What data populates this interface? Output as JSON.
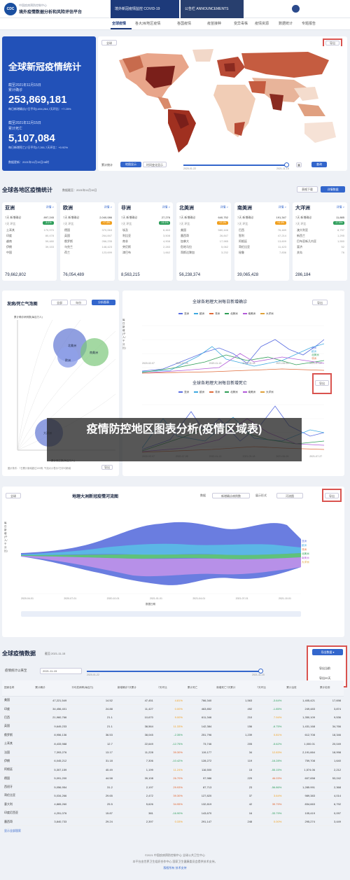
{
  "header": {
    "org": "中国疾病预防控制中心",
    "platform": "境外疫情数据分析和风险评估平台",
    "logo": "CDC",
    "top_tabs": [
      "境外新冠疫情监控 COVID-19",
      "公告栏 ANNOUNCEMENTS"
    ]
  },
  "nav": [
    "全球疫情",
    "各大洲/地区疫情",
    "各国疫情",
    "疫苗接种",
    "变异毒株",
    "疫情资源",
    "数据统计",
    "专题报告"
  ],
  "world": {
    "panel_title": "全球新冠疫情统计",
    "cum_date": "截至2021年11月15日",
    "cum_label": "累计确诊",
    "cum_value": "253,869,181",
    "cum_note": "每日新增确诊(7日平均):494,264,7天环比：+7.25%",
    "death_date": "截至2021年11月15日",
    "death_label": "累计死亡",
    "death_value": "5,107,084",
    "death_note": "每日新增死亡(7日平均):7,261,7天环比：+0.92%",
    "update": "数据更新：2021年11月15日08时",
    "map_select": "全球",
    "map_btn": "导出",
    "stat_label": "累计统计",
    "toggle_a": "地图显示",
    "toggle_b": "时间变化显示",
    "date_start": "2020-01-22",
    "date_end": "2021-11-15",
    "query_btn": "查询"
  },
  "regions": {
    "title": "全球各地区疫情统计",
    "date": "数据截至：2021年11月15日",
    "btn_export": "表格下载",
    "btn_detail": "详情数据",
    "items": [
      {
        "name": "亚洲",
        "link": "详情 >",
        "lbl": "7天 新增确诊",
        "val": "897,245",
        "badge": "-8.1%",
        "badge_color": "#2e9e5b",
        "trend": "7天 环比",
        "rows": [
          [
            "土耳其",
            "170,970"
          ],
          [
            "印度",
            "80,478"
          ],
          [
            "越南",
            "59,480"
          ],
          [
            "伊朗",
            "39,153"
          ],
          [
            "中国",
            ""
          ]
        ],
        "total": "79,662,802"
      },
      {
        "name": "欧洲",
        "link": "详情 >",
        "lbl": "7天 新增确诊",
        "val": "2,040,086",
        "badge": "+7.4%",
        "badge_color": "#f0a020",
        "trend": "7天 环比",
        "rows": [
          [
            "德国",
            "370,063"
          ],
          [
            "英国",
            "264,847"
          ],
          [
            "俄罗斯",
            "266,235"
          ],
          [
            "乌克兰",
            "148,423"
          ],
          [
            "荷兰",
            "123,699"
          ]
        ],
        "total": "76,054,489"
      },
      {
        "name": "非洲",
        "link": "详情 >",
        "lbl": "7天 新增确诊",
        "val": "27,276",
        "badge": "-16.1%",
        "badge_color": "#2e9e5b",
        "trend": "7天 环比",
        "rows": [
          [
            "埃及",
            "6,463"
          ],
          [
            "利比亚",
            "3,508"
          ],
          [
            "南非",
            "4,908"
          ],
          [
            "突尼斯",
            "2,283"
          ],
          [
            "津巴布",
            "1,662"
          ]
        ],
        "total": "8,563,215"
      },
      {
        "name": "北美洲",
        "link": "详情 >",
        "lbl": "7天 新增确诊",
        "val": "640,752",
        "badge": "+2.1%",
        "badge_color": "#f0a020",
        "trend": "7天 环比",
        "rows": [
          [
            "美国",
            "580,446"
          ],
          [
            "墨西哥",
            "26,847"
          ],
          [
            "加拿大",
            "17,985"
          ],
          [
            "危地马拉",
            "5,062"
          ],
          [
            "哥斯达黎加",
            "3,232"
          ]
        ],
        "total": "56,238,374"
      },
      {
        "name": "南美洲",
        "link": "详情 >",
        "lbl": "7天 新增确诊",
        "val": "191,347",
        "badge": "+4.4%",
        "badge_color": "#f0a020",
        "trend": "7天 环比",
        "rows": [
          [
            "巴西",
            "76,489"
          ],
          [
            "智利",
            "47,214"
          ],
          [
            "阿根廷",
            "13,609"
          ],
          [
            "哥伦比亚",
            "11,423"
          ],
          [
            "秘鲁",
            "7,836"
          ]
        ],
        "total": "39,065,428"
      },
      {
        "name": "大洋洲",
        "link": "详情 >",
        "lbl": "7天 新增确诊",
        "val": "11,885",
        "badge": "-17.8%",
        "badge_color": "#2e9e5b",
        "trend": "7天 环比",
        "rows": [
          [
            "澳大利亚",
            "8,797"
          ],
          [
            "新西兰",
            "1,295"
          ],
          [
            "巴布亚新几内亚",
            "1,550"
          ],
          [
            "斐济",
            "52"
          ],
          [
            "关岛",
            "76"
          ]
        ],
        "total": "286,184"
      }
    ]
  },
  "bubble": {
    "title": "发病/死亡气泡图",
    "select": "全部",
    "select2": "年份",
    "btn": "分析图表",
    "yaxis": "累计确诊病例数(每百万人)",
    "xaxis": "累计死亡数(每百万人)",
    "note": "图示条件：7日累计新增超过100例, 气泡大小表示7日平均新增",
    "export": "导出",
    "bubbles": [
      {
        "label": "北美洲",
        "color": "#6b7fd6"
      },
      {
        "label": "南美洲",
        "color": "#7cc77a"
      },
      {
        "label": "欧洲",
        "color": "#6b7fd6"
      },
      {
        "label": "大洋洲",
        "color": "#6b7fd6"
      }
    ]
  },
  "lines": {
    "export": "导出",
    "chart1_title": "全球各地理大洲每日新增确诊",
    "chart2_title": "全球各地理大洲每日新增死亡",
    "legend": [
      "亚洲",
      "欧洲",
      "非洲",
      "北美洲",
      "南美洲",
      "大洋洲"
    ],
    "legend_colors": [
      "#5b6ee1",
      "#3fa9e0",
      "#e06b3a",
      "#2f9e57",
      "#b35bd9",
      "#e0a23a"
    ],
    "ylabel1": "每日新增(千人/千分比)",
    "x_ticks": [
      "2020-02-07",
      "2020-07-05",
      "2020-11-13",
      "2021-03-18",
      "2021-06-05",
      "2021-07-27"
    ]
  },
  "stream": {
    "region_select": "全球",
    "title": "地理大洲新冠疫情河流图",
    "label_data": "数据",
    "data_select": "新增确诊病例数",
    "label_display": "展示形式",
    "display_select": "河流图",
    "btn": "导出",
    "ylabel": "每日新增(千人/千分比)",
    "xlabel": "数据日期",
    "x_ticks": [
      "2020-04-01",
      "2020-07-01",
      "2020-10-01",
      "2021-01-01",
      "2021-04-01",
      "2021-07-01",
      "2021-10-01"
    ],
    "legend": [
      "亚洲",
      "欧洲",
      "非洲",
      "北美洲",
      "南美洲",
      "大洋洲"
    ]
  },
  "table": {
    "title": "全球疫情数据",
    "date": "截至:2021-11-15",
    "filter_label": "疫情统计以来至",
    "filter_value": "2021-11-15",
    "slider_start": "2020-01-22",
    "slider_end": "2021-11-15",
    "export_btn": "导出数据",
    "menu": [
      "导出当前",
      "导出20天"
    ],
    "columns": [
      "国家名称",
      "累计确诊",
      "平均发病率(每百万)",
      "新增确诊7天累计",
      "7天环比",
      "累计死亡",
      "新增死亡7天累计",
      "7天环比",
      "累计治愈",
      "累计检测"
    ],
    "rows": [
      [
        "美国",
        "47,221,549",
        "14.52",
        "47,451",
        "4.81%",
        "766,340",
        "1,563",
        "-3.64%",
        "1,405,421",
        "17,698"
      ],
      [
        "印度",
        "34,456,401",
        "24.88",
        "11,427",
        "0.00%",
        "463,852",
        "492",
        "-1.85%",
        "249,483",
        "3,874"
      ],
      [
        "巴西",
        "21,960,766",
        "21.1",
        "10,670",
        "9.00%",
        "611,346",
        "210",
        "7.94%",
        "1,350,109",
        "9,536"
      ],
      [
        "英国",
        "9,649,233",
        "21.1",
        "38,564",
        "11.33%",
        "142,384",
        "156",
        "-6.75%",
        "1,431,168",
        "34,766"
      ],
      [
        "俄罗斯",
        "8,956,136",
        "36.53",
        "38,045",
        "-2.35%",
        "251,796",
        "1,239",
        "0.81%",
        "612,708",
        "18,346"
      ],
      [
        "土耳其",
        "8,433,988",
        "12.7",
        "22,649",
        "-12.75%",
        "73,746",
        "205",
        "-5.62%",
        "1,000.01",
        "20,049"
      ],
      [
        "法国",
        "7,393,276",
        "13.17",
        "11,228",
        "39.30%",
        "119,177",
        "34",
        "12.83%",
        "2,191,664",
        "18,998"
      ],
      [
        "伊朗",
        "6,045,212",
        "31.18",
        "7,306",
        "-10.42%",
        "128,272",
        "119",
        "-16.28%",
        "759,708",
        "1,640"
      ],
      [
        "阿根廷",
        "5,307,159",
        "40.49",
        "1,199",
        "11.24%",
        "116,500",
        "15",
        "-55.15%",
        "1,574.06",
        "2,212"
      ],
      [
        "德国",
        "5,091,200",
        "44.58",
        "39,108",
        "26.70%",
        "97,986",
        "229",
        "46.03%",
        "607,658",
        "53,242"
      ],
      [
        "西班牙",
        "5,056,954",
        "31.2",
        "2,197",
        "29.93%",
        "87,713",
        "23",
        "-56.86%",
        "1,285.991",
        "2,368"
      ],
      [
        "哥伦比亚",
        "5,034,266",
        "29.65",
        "2,472",
        "39.30%",
        "127,820",
        "37",
        "3.64%",
        "989,383",
        "4,014"
      ],
      [
        "意大利",
        "4,865,260",
        "25.5",
        "5,626",
        "34.95%",
        "132,819",
        "42",
        "39.79%",
        "834,663",
        "6,792"
      ],
      [
        "印度尼西亚",
        "4,251,076",
        "15.87",
        "381",
        "-16.90%",
        "143,670",
        "16",
        "-33.79%",
        "105,419",
        "0,097"
      ],
      [
        "墨西哥",
        "3,840,733",
        "29.24",
        "2,397",
        "0.33%",
        "291,147",
        "248",
        "0.00%",
        "295,274",
        "3,449"
      ]
    ],
    "show_more": "显示全部国家"
  },
  "overlay": {
    "text": "疫情防控地区图表分析(疫情区域表)"
  },
  "footer": {
    "line1": "©2021 中国疾病预防控制中心 全球公共卫生中心",
    "line2": "本平台由世界卫生组织合作中心 国家卫生健康委员会提供技术支持。",
    "line3": "版权所有 技术支持"
  }
}
